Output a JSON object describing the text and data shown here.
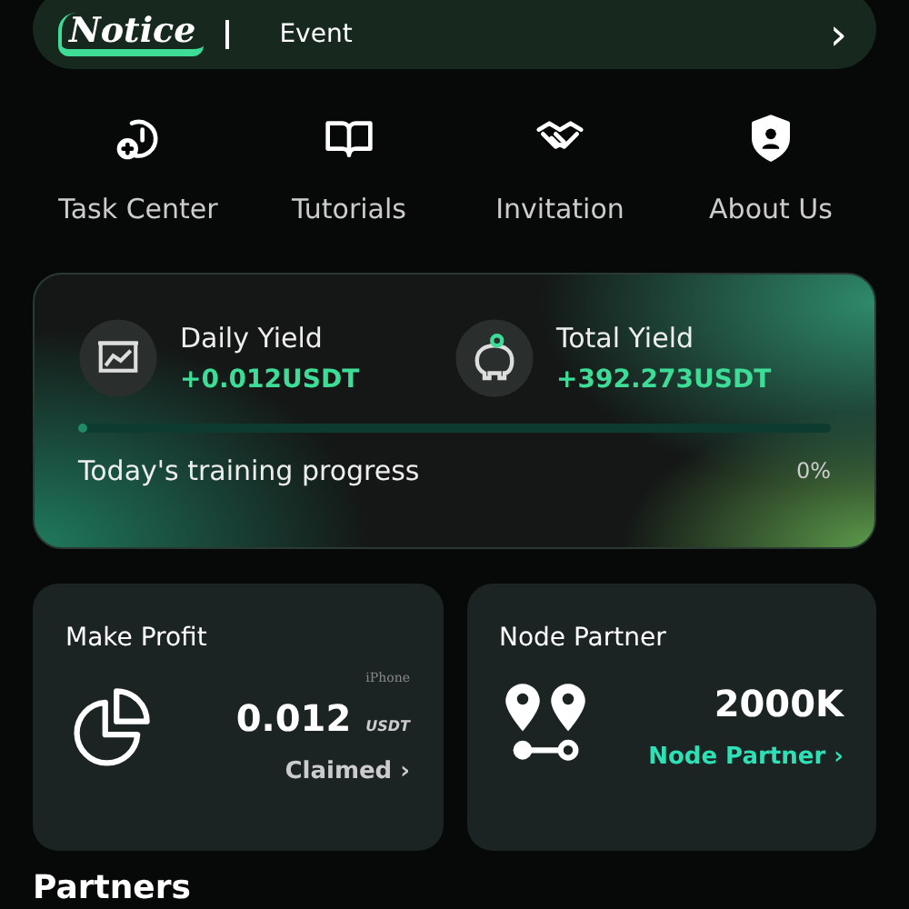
{
  "notice": {
    "logo": "Notice",
    "text": "Event",
    "arrow": "›"
  },
  "menu": [
    {
      "label": "Task Center",
      "kind": "task"
    },
    {
      "label": "Tutorials",
      "kind": "book"
    },
    {
      "label": "Invitation",
      "kind": "handshake"
    },
    {
      "label": "About Us",
      "kind": "shield"
    }
  ],
  "yield": {
    "stats": [
      {
        "title": "Daily Yield",
        "value": "+0.012USDT",
        "kind": "chart"
      },
      {
        "title": "Total Yield",
        "value": "+392.273USDT",
        "kind": "piggy"
      }
    ],
    "progress": {
      "level": 0,
      "label": "Today's training progress",
      "reading": "0%"
    }
  },
  "cards": [
    {
      "title": "Make Profit",
      "kind": "pie",
      "note": "iPhone",
      "value": "0.012",
      "unit": "USDT",
      "link": "Claimed ›",
      "highlight": false
    },
    {
      "title": "Node Partner",
      "kind": "nodes",
      "value": "2000K",
      "link": "Node Partner ›",
      "highlight": true
    }
  ],
  "section": {
    "title": "Partners"
  }
}
